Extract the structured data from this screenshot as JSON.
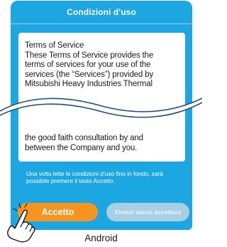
{
  "dialog": {
    "title": "Condizioni d'uso",
    "terms_lines_top": [
      "Terms of Service",
      "These Terms of Service provides the",
      "terms of services for your use of the",
      "services (the “Services”) provided by",
      "Mitsubishi Heavy Industries Thermal"
    ],
    "terms_lines_bottom": [
      "the good faith consultation by and",
      "between the Company and you."
    ],
    "note": "Una volta lette le condizioni d'uso fino in fondo, sarà possibile premere il tasto Accetto.",
    "accept_label": "Accetto",
    "finish_label": "Finisci senza accettare",
    "accept_enabled": true,
    "finish_enabled": false
  },
  "caption": "Android",
  "colors": {
    "background": "#1ca6e2",
    "accept": "#f79421",
    "finish_disabled": "#a9cfe2",
    "panel": "#ffffff"
  },
  "icons": [
    "tapping-hand-icon"
  ]
}
